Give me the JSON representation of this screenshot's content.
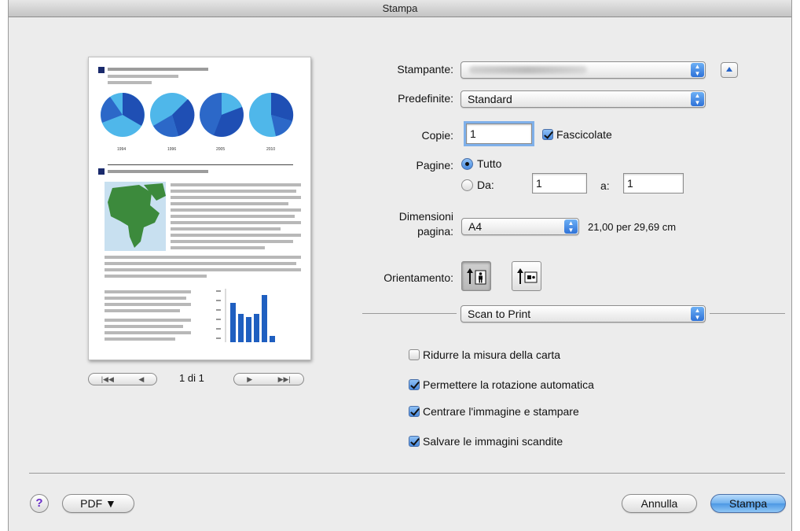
{
  "window": {
    "title": "Stampa"
  },
  "printer": {
    "label": "Stampante:",
    "value": ""
  },
  "presets": {
    "label": "Predefinite:",
    "value": "Standard"
  },
  "copies": {
    "label": "Copie:",
    "value": "1",
    "collate_label": "Fascicolate",
    "collate_checked": true
  },
  "pages": {
    "label": "Pagine:",
    "all_label": "Tutto",
    "from_label": "Da:",
    "from_value": "1",
    "to_label": "a:",
    "to_value": "1",
    "selected": "all"
  },
  "paper_size": {
    "label_line1": "Dimensioni",
    "label_line2": "pagina:",
    "value": "A4",
    "dimensions": "21,00 per 29,69 cm"
  },
  "orientation": {
    "label": "Orientamento:",
    "options": [
      "portrait",
      "landscape"
    ],
    "selected": "portrait"
  },
  "section": {
    "value": "Scan to Print"
  },
  "options": [
    {
      "label": "Ridurre la misura della carta",
      "checked": false
    },
    {
      "label": "Permettere la rotazione automatica",
      "checked": true
    },
    {
      "label": "Centrare l'immagine e stampare",
      "checked": true
    },
    {
      "label": "Salvare le immagini scandite",
      "checked": true
    }
  ],
  "preview": {
    "page_indicator": "1 di 1",
    "pie_labels": [
      "1994",
      "1996",
      "2005",
      "2010"
    ]
  },
  "footer": {
    "help": "?",
    "pdf_label": "PDF ▼",
    "cancel_label": "Annulla",
    "print_label": "Stampa"
  },
  "colors": {
    "accent": "#4c98e4",
    "chart_blue": "#1f4fb4",
    "chart_light": "#4fb7ea",
    "map_green": "#3c8a3c"
  }
}
